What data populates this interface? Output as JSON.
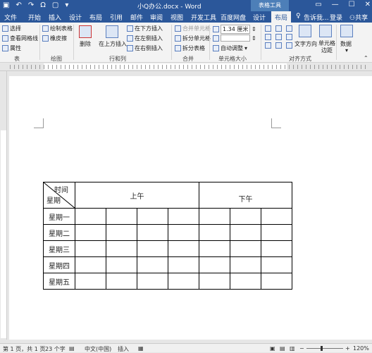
{
  "titlebar": {
    "title": "小Q办公.docx - Word",
    "context_tab": "表格工具"
  },
  "tabs": [
    "文件",
    "开始",
    "插入",
    "设计",
    "布局",
    "引用",
    "邮件",
    "审阅",
    "视图",
    "开发工具",
    "百度网盘",
    "设计",
    "布局"
  ],
  "tab_extras": {
    "tell_me": "告诉我...",
    "login": "登录",
    "share": "共享"
  },
  "ribbon": {
    "table_group": {
      "select": "选择",
      "gridlines": "查看网格线",
      "properties": "属性",
      "label": "表"
    },
    "draw_group": {
      "draw_table": "绘制表格",
      "eraser": "橡皮擦",
      "label": "绘图"
    },
    "rows_cols_group": {
      "delete": "删除",
      "insert_above": "在上方插入",
      "insert_below": "在下方插入",
      "insert_left": "在左侧插入",
      "insert_right": "在右侧插入",
      "label": "行和列"
    },
    "merge_group": {
      "merge_cells": "合并单元格",
      "split_cells": "拆分单元格",
      "split_table": "拆分表格",
      "label": "合并"
    },
    "cell_size_group": {
      "height": "1.34 厘米",
      "autofit": "自动调整",
      "label": "单元格大小"
    },
    "align_group": {
      "text_direction": "文字方向",
      "cell_margins_1": "单元格",
      "cell_margins_2": "边距",
      "label": "对齐方式"
    },
    "data_group": {
      "data": "数据"
    }
  },
  "table": {
    "header_top": "时间",
    "header_bottom": "星期",
    "morning": "上午",
    "afternoon": "下午",
    "days": [
      "星期一",
      "星期二",
      "星期三",
      "星期四",
      "星期五"
    ]
  },
  "status": {
    "page": "第 1 页，共 1 页",
    "words": "23 个字",
    "language": "中文(中国)",
    "mode": "插入",
    "zoom": "120%"
  }
}
